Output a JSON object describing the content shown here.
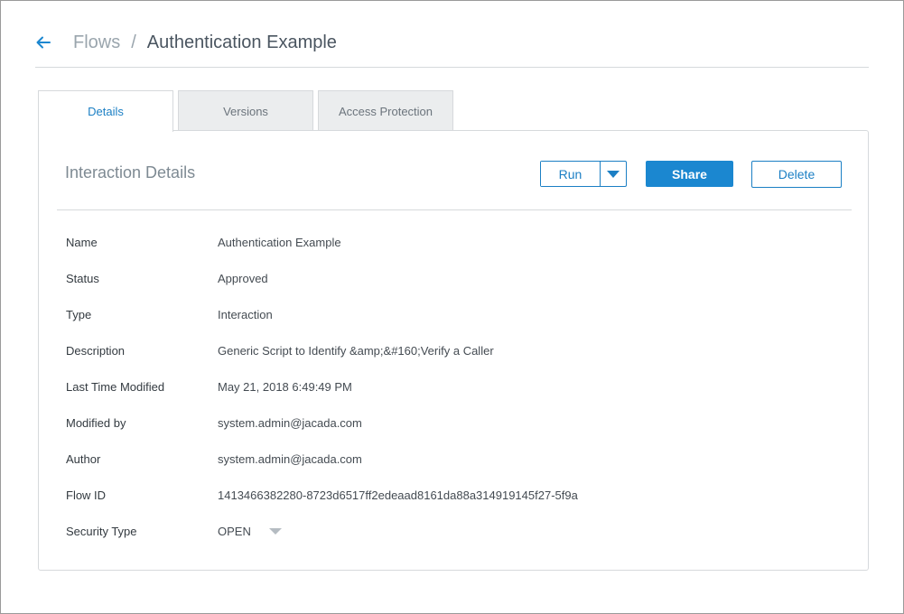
{
  "breadcrumb": {
    "parent": "Flows",
    "separator": "/",
    "current": "Authentication Example"
  },
  "tabs": [
    {
      "label": "Details",
      "active": true
    },
    {
      "label": "Versions",
      "active": false
    },
    {
      "label": "Access Protection",
      "active": false
    }
  ],
  "panel": {
    "title": "Interaction Details",
    "actions": {
      "run_label": "Run",
      "share_label": "Share",
      "delete_label": "Delete"
    }
  },
  "details": [
    {
      "label": "Name",
      "value": "Authentication Example"
    },
    {
      "label": "Status",
      "value": "Approved"
    },
    {
      "label": "Type",
      "value": "Interaction"
    },
    {
      "label": "Description",
      "value": "Generic Script to Identify &amp;&#160;Verify a Caller"
    },
    {
      "label": "Last Time Modified",
      "value": "May 21, 2018 6:49:49 PM"
    },
    {
      "label": "Modified by",
      "value": "system.admin@jacada.com"
    },
    {
      "label": "Author",
      "value": "system.admin@jacada.com"
    },
    {
      "label": "Flow ID",
      "value": "1413466382280-8723d6517ff2edeaad8161da88a314919145f27-5f9a"
    },
    {
      "label": "Security Type",
      "value": "OPEN"
    }
  ],
  "colors": {
    "accent": "#1b7fc4",
    "primary_button": "#1b87d0",
    "muted_text": "#9aa5ad",
    "border": "#d6d9dc"
  },
  "icons": {
    "back": "arrow-left-icon",
    "run_menu": "caret-down-icon",
    "security_dropdown": "caret-down-icon"
  }
}
